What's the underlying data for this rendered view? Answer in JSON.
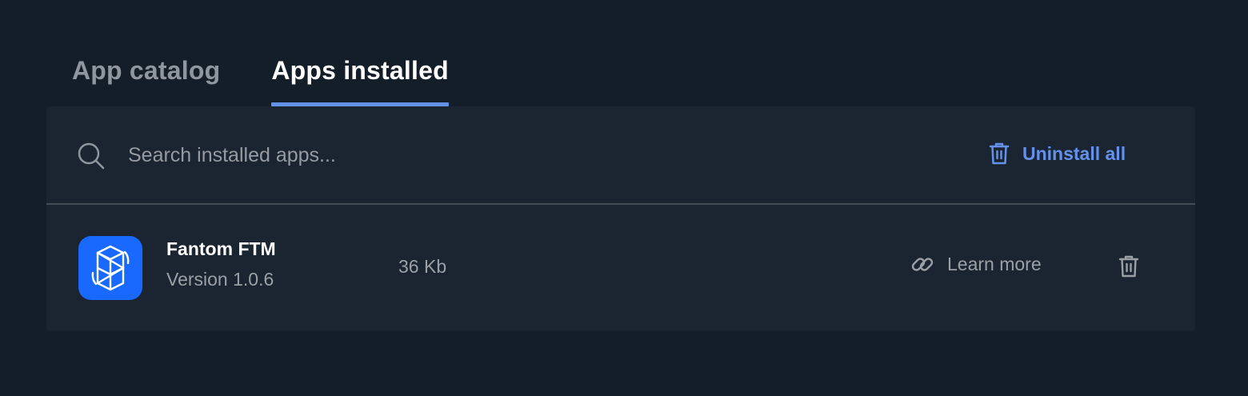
{
  "tabs": [
    {
      "label": "App catalog",
      "active": false
    },
    {
      "label": "Apps installed",
      "active": true
    }
  ],
  "search": {
    "placeholder": "Search installed apps...",
    "value": ""
  },
  "toolbar": {
    "uninstall_all_label": "Uninstall all",
    "uninstall_all_icon": "trash-icon"
  },
  "apps": [
    {
      "name": "Fantom FTM",
      "version": "Version 1.0.6",
      "size": "36 Kb",
      "icon": "fantom-logo-icon",
      "learn_more_label": "Learn more",
      "learn_more_icon": "link-icon",
      "delete_icon": "trash-icon"
    }
  ],
  "colors": {
    "background": "#131e28",
    "panel": "#1b2531",
    "accent": "#6492ea",
    "fantom_blue": "#1969ff",
    "muted_text": "#9aa0a6"
  }
}
